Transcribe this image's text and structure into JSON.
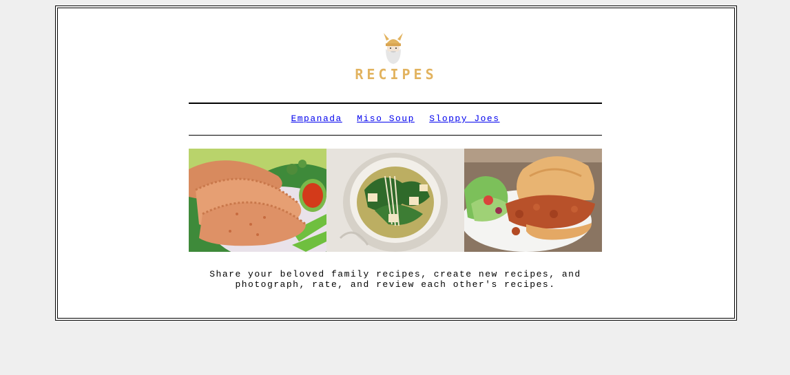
{
  "brand": {
    "logo_icon": "viking-helmet-bearded-chef-icon",
    "title": "RECIPES",
    "accent_color": "#e2b35f"
  },
  "nav": {
    "links": [
      {
        "label": "Empanada"
      },
      {
        "label": "Miso Soup"
      },
      {
        "label": "Sloppy Joes"
      }
    ],
    "link_color": "#0000ee"
  },
  "gallery": {
    "photos": [
      {
        "subject": "empanadas-photo"
      },
      {
        "subject": "miso-soup-photo"
      },
      {
        "subject": "sloppy-joe-photo"
      }
    ]
  },
  "tagline": "Share your beloved family recipes, create new recipes, and photograph, rate, and review each other's recipes."
}
